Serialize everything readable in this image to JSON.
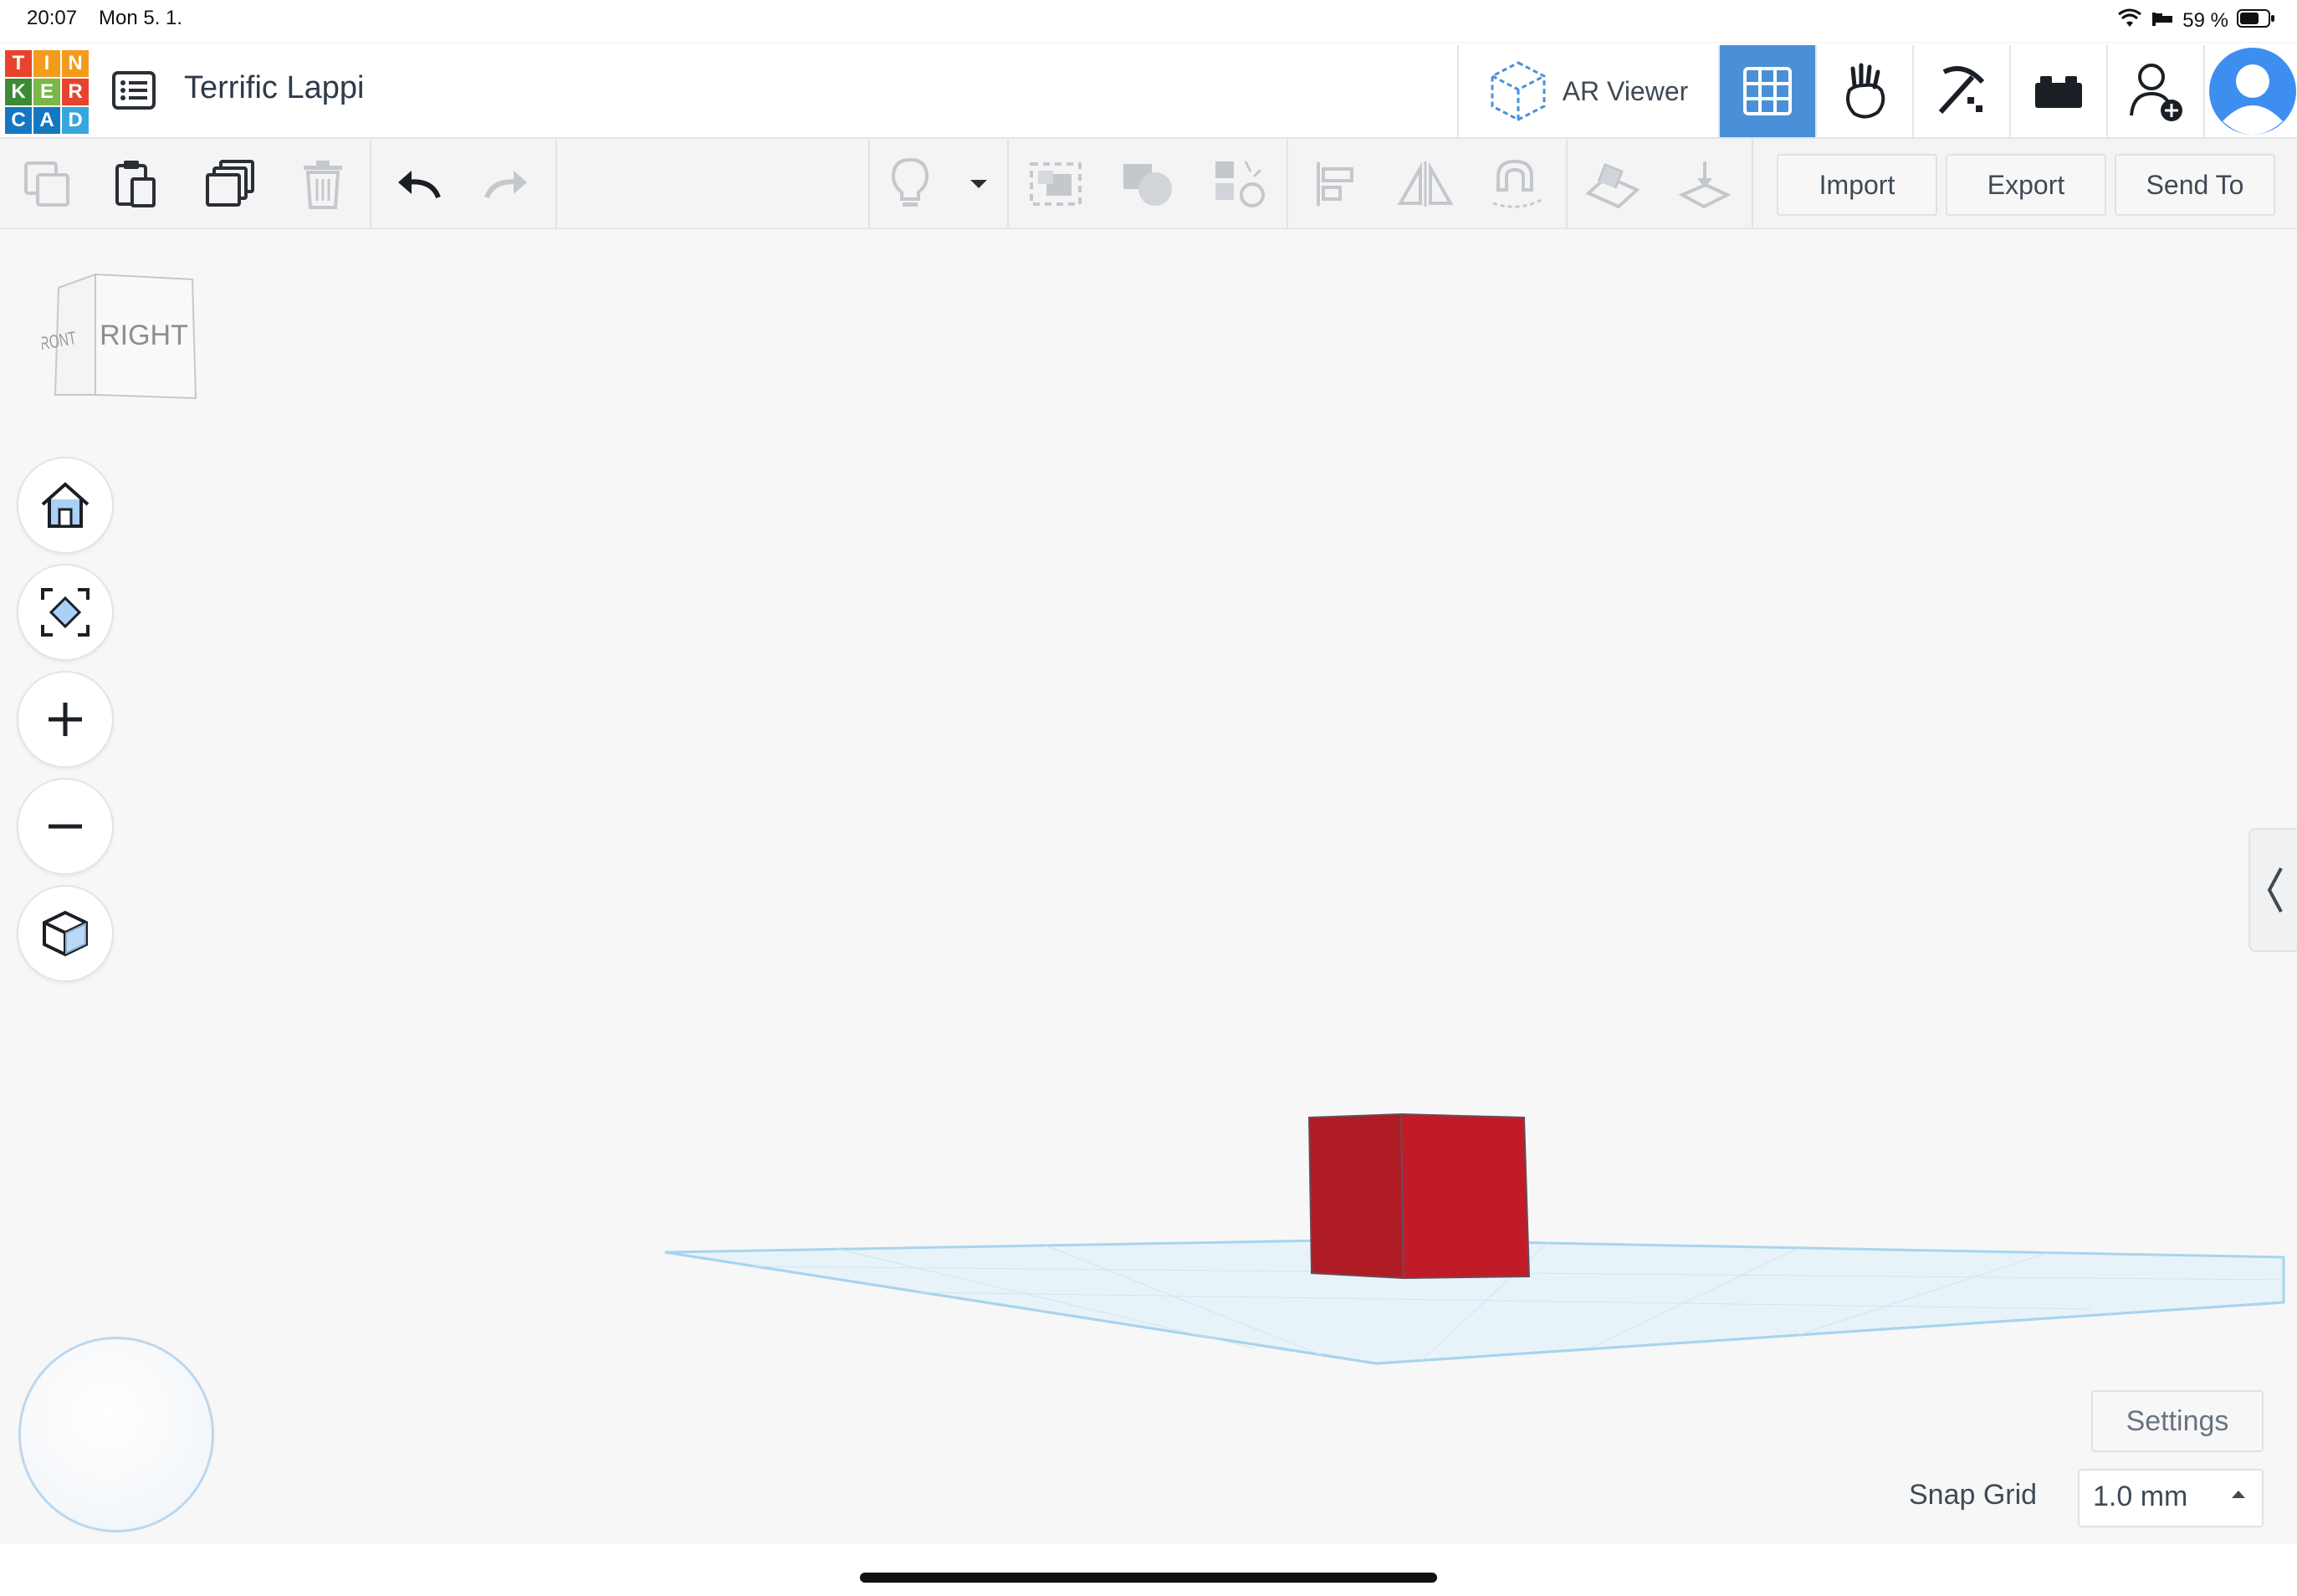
{
  "status_bar": {
    "time": "20:07",
    "date": "Mon 5. 1.",
    "battery": "59 %"
  },
  "app": {
    "logo_letters": [
      "T",
      "I",
      "N",
      "K",
      "E",
      "R",
      "C",
      "A",
      "D"
    ],
    "logo_colors": [
      "#e8432d",
      "#f39c1b",
      "#f39c1b",
      "#3d8a36",
      "#7ab648",
      "#e8432d",
      "#1477c2",
      "#1477c2",
      "#38a6de"
    ],
    "design_title": "Terrific Lappi"
  },
  "top_right": {
    "ar_viewer_label": "AR Viewer",
    "active_view_color": "#4a90d9"
  },
  "toolbar": {
    "import_label": "Import",
    "export_label": "Export",
    "send_to_label": "Send To"
  },
  "view_cube": {
    "front_label": "FRONT",
    "right_label": "RIGHT"
  },
  "workplane": {
    "grid_color": "#a8d4ee",
    "plane_color": "#e6f2f8"
  },
  "scene": {
    "box_color": "#c0202a"
  },
  "bottom": {
    "settings_label": "Settings",
    "snap_grid_label": "Snap Grid",
    "snap_grid_value": "1.0 mm"
  }
}
